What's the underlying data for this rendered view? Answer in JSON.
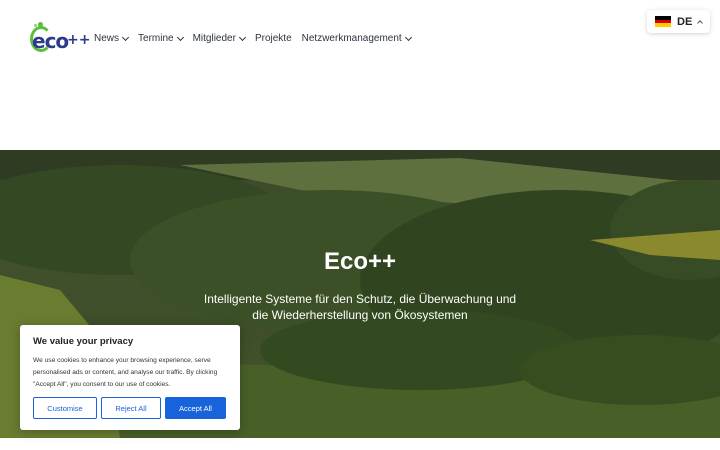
{
  "logo": {
    "word": "eco",
    "plus": "++"
  },
  "nav": {
    "items": [
      {
        "label": "News",
        "has_dropdown": true
      },
      {
        "label": "Termine",
        "has_dropdown": true
      },
      {
        "label": "Mitglieder",
        "has_dropdown": true
      },
      {
        "label": "Projekte",
        "has_dropdown": false
      },
      {
        "label": "Netzwerkmanagement",
        "has_dropdown": true
      }
    ]
  },
  "language": {
    "code": "DE",
    "flag": "germany-flag-icon",
    "flag_colors": [
      "#000000",
      "#dd0000",
      "#ffce00"
    ]
  },
  "hero": {
    "title": "Eco++",
    "subtitle": "Intelligente Systeme für den Schutz, die Überwachung und die Wiederherstellung von Ökosystemen"
  },
  "cookie": {
    "title": "We value your privacy",
    "text": "We use cookies to enhance your browsing experience, serve personalised ads or content, and analyse our traffic. By clicking \"Accept All\", you consent to our use of cookies.",
    "customise_label": "Customise",
    "reject_label": "Reject All",
    "accept_label": "Accept All"
  },
  "colors": {
    "accent": "#1863dc",
    "logo_blue": "#2e3a8c",
    "logo_green": "#5bbf3c"
  }
}
